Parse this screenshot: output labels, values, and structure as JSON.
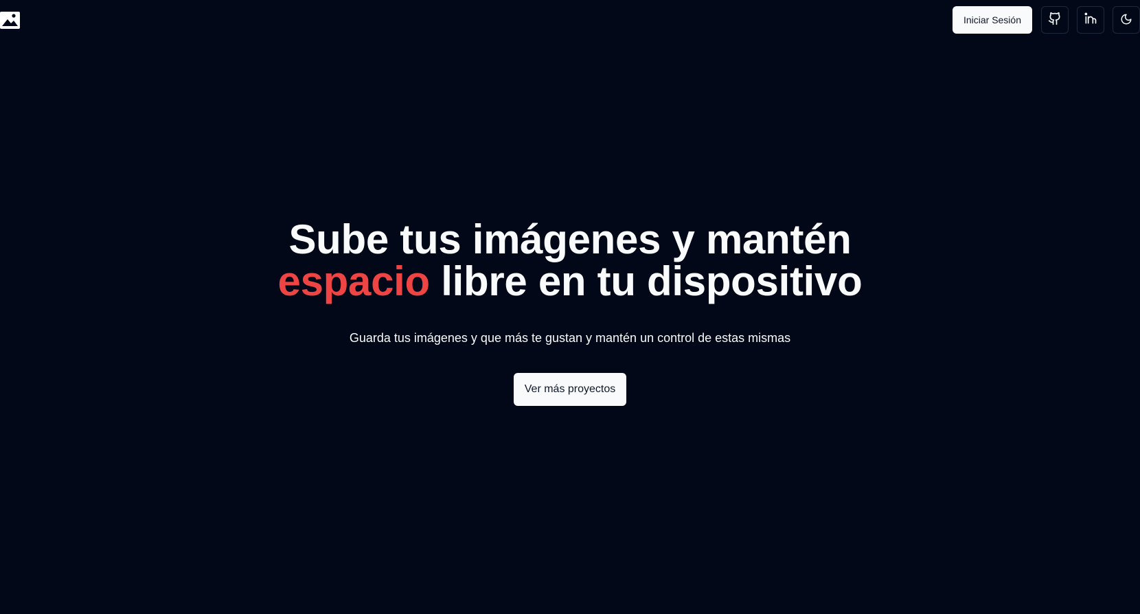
{
  "header": {
    "logo_icon": "image-icon",
    "login_label": "Iniciar Sesión",
    "social_icons": [
      "github-icon",
      "linkedin-icon"
    ],
    "theme_icon": "moon-icon"
  },
  "hero": {
    "title_line1": "Sube tus imágenes y mantén",
    "title_accent": "espacio",
    "title_line2_rest": " libre en tu dispositivo",
    "subtitle": "Guarda tus imágenes y que más te gustan y mantén un control de estas mismas",
    "cta_label": "Ver más proyectos"
  },
  "colors": {
    "background": "#020817",
    "accent": "#ef4444",
    "button_bg": "#f8fafc",
    "button_text": "#0f172a"
  }
}
